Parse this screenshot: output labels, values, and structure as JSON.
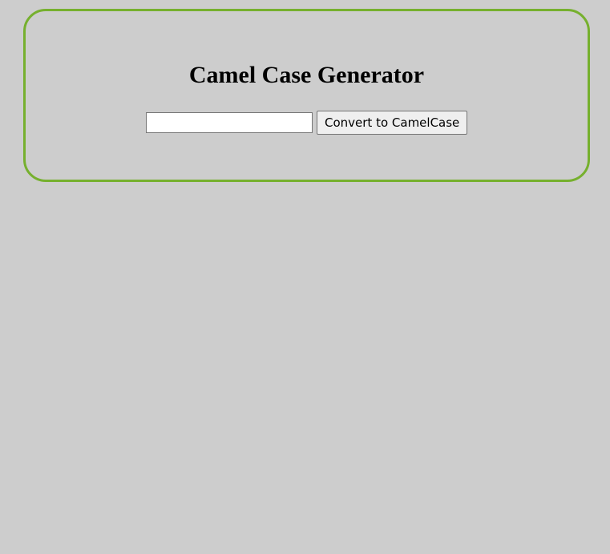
{
  "app": {
    "title": "Camel Case Generator"
  },
  "form": {
    "input_value": "",
    "input_placeholder": "",
    "convert_label": "Convert to CamelCase"
  },
  "colors": {
    "background": "#cdcdcd",
    "card_border": "#76b02e"
  }
}
